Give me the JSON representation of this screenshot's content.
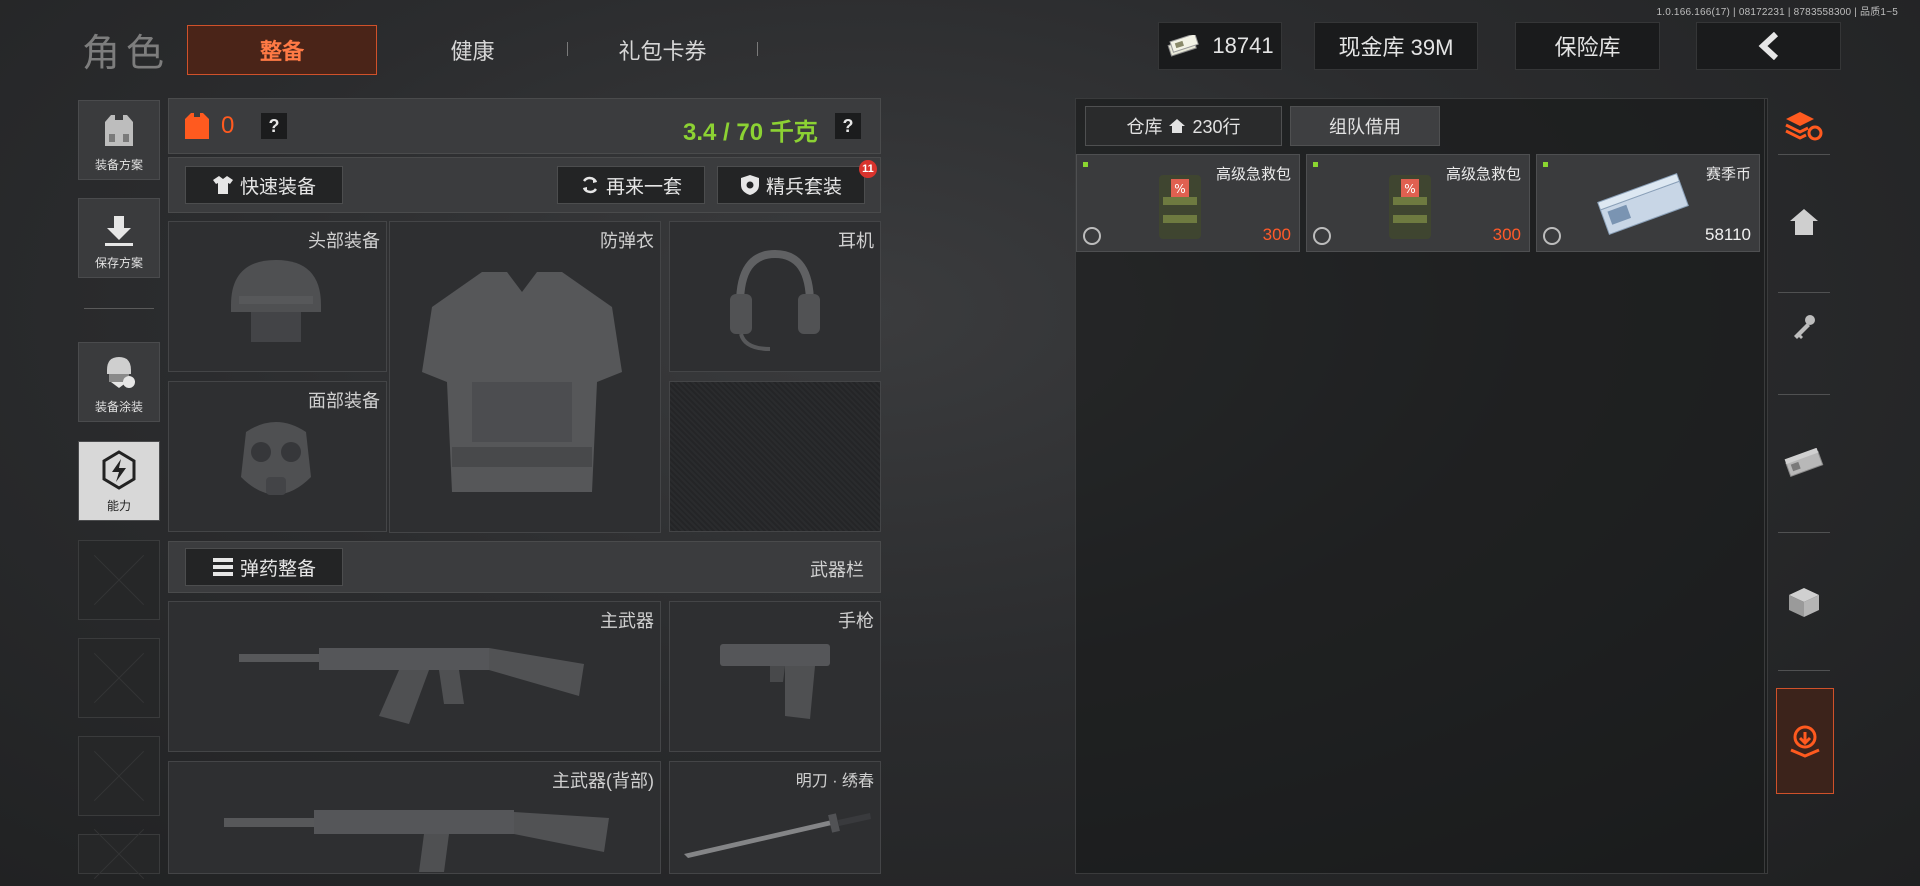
{
  "version": "1.0.166.166(17) | 08172231 | 8783558300 | 品质1~5",
  "page_title": "角色",
  "tabs": [
    {
      "label": "整备",
      "active": true
    },
    {
      "label": "健康",
      "active": false
    },
    {
      "label": "礼包卡券",
      "active": false
    }
  ],
  "header": {
    "currency": "18741",
    "cash_vault": "现金库 39M",
    "safe_vault": "保险库"
  },
  "sidebar": {
    "items": [
      {
        "label": "装备方案",
        "icon": "vest-icon"
      },
      {
        "label": "保存方案",
        "icon": "download-icon"
      },
      {
        "label": "装备涂装",
        "icon": "helmet-skin-icon"
      },
      {
        "label": "能力",
        "icon": "ability-icon",
        "active": true
      }
    ]
  },
  "loadout": {
    "armor_count": "0",
    "help": "?",
    "weight": "3.4 / 70 千克",
    "quick_equip": "快速装备",
    "repeat": "再来一套",
    "elite_set": "精兵套装",
    "elite_badge": "11",
    "slots": {
      "head": "头部装备",
      "armor": "防弹衣",
      "headset": "耳机",
      "face": "面部装备"
    },
    "ammo_button": "弹药整备",
    "weapon_bar": "武器栏",
    "weapons": {
      "primary": "主武器",
      "pistol": "手枪",
      "primary_back": "主武器(背部)",
      "melee": "明刀 · 绣春"
    }
  },
  "warehouse": {
    "tab_storage": "仓库",
    "storage_count": "230行",
    "tab_team": "组队借用",
    "items": [
      {
        "name": "高级急救包",
        "value": "300",
        "value_color": "#ff5a2a"
      },
      {
        "name": "高级急救包",
        "value": "300",
        "value_color": "#ff5a2a"
      },
      {
        "name": "赛季币",
        "value": "58110",
        "value_color": "#f0f0f0"
      }
    ]
  },
  "colors": {
    "accent": "#d0512a",
    "weight_green": "#8cd233"
  }
}
